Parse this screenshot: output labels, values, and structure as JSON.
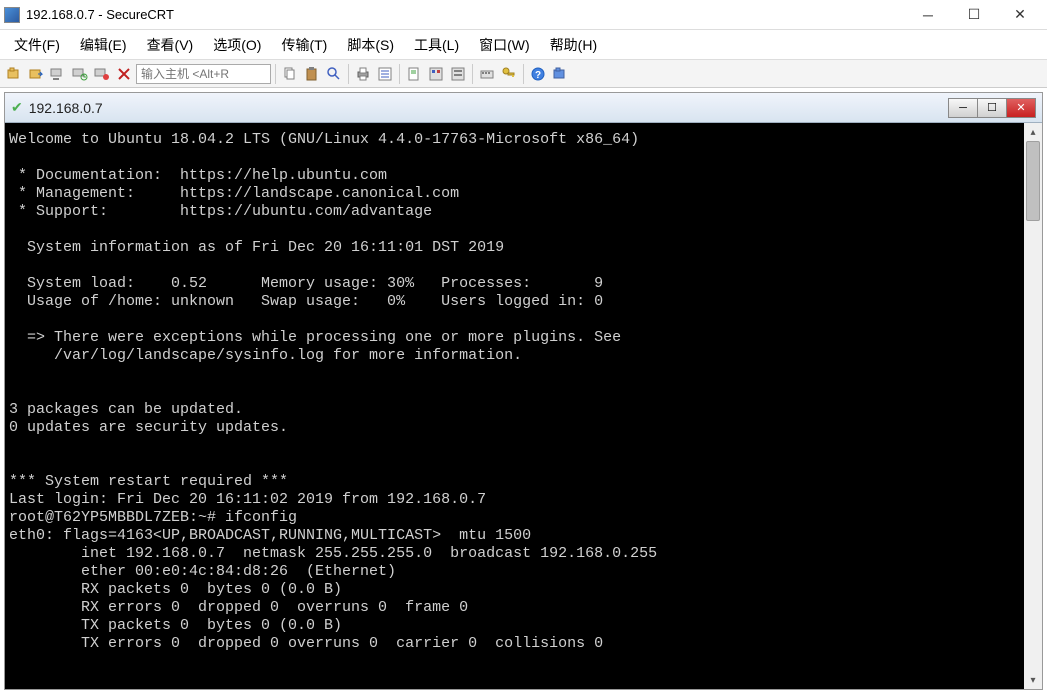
{
  "window": {
    "title": "192.168.0.7 - SecureCRT"
  },
  "menu": {
    "file": "文件(F)",
    "edit": "编辑(E)",
    "view": "查看(V)",
    "options": "选项(O)",
    "transfer": "传输(T)",
    "script": "脚本(S)",
    "tools": "工具(L)",
    "window": "窗口(W)",
    "help": "帮助(H)"
  },
  "toolbar": {
    "host_placeholder": "输入主机 <Alt+R"
  },
  "session": {
    "title": "192.168.0.7"
  },
  "terminal": {
    "lines": [
      "Welcome to Ubuntu 18.04.2 LTS (GNU/Linux 4.4.0-17763-Microsoft x86_64)",
      "",
      " * Documentation:  https://help.ubuntu.com",
      " * Management:     https://landscape.canonical.com",
      " * Support:        https://ubuntu.com/advantage",
      "",
      "  System information as of Fri Dec 20 16:11:01 DST 2019",
      "",
      "  System load:    0.52      Memory usage: 30%   Processes:       9",
      "  Usage of /home: unknown   Swap usage:   0%    Users logged in: 0",
      "",
      "  => There were exceptions while processing one or more plugins. See",
      "     /var/log/landscape/sysinfo.log for more information.",
      "",
      "",
      "3 packages can be updated.",
      "0 updates are security updates.",
      "",
      "",
      "*** System restart required ***",
      "Last login: Fri Dec 20 16:11:02 2019 from 192.168.0.7",
      "root@T62YP5MBBDL7ZEB:~# ifconfig",
      "eth0: flags=4163<UP,BROADCAST,RUNNING,MULTICAST>  mtu 1500",
      "        inet 192.168.0.7  netmask 255.255.255.0  broadcast 192.168.0.255",
      "        ether 00:e0:4c:84:d8:26  (Ethernet)",
      "        RX packets 0  bytes 0 (0.0 B)",
      "        RX errors 0  dropped 0  overruns 0  frame 0",
      "        TX packets 0  bytes 0 (0.0 B)",
      "        TX errors 0  dropped 0 overruns 0  carrier 0  collisions 0"
    ]
  }
}
